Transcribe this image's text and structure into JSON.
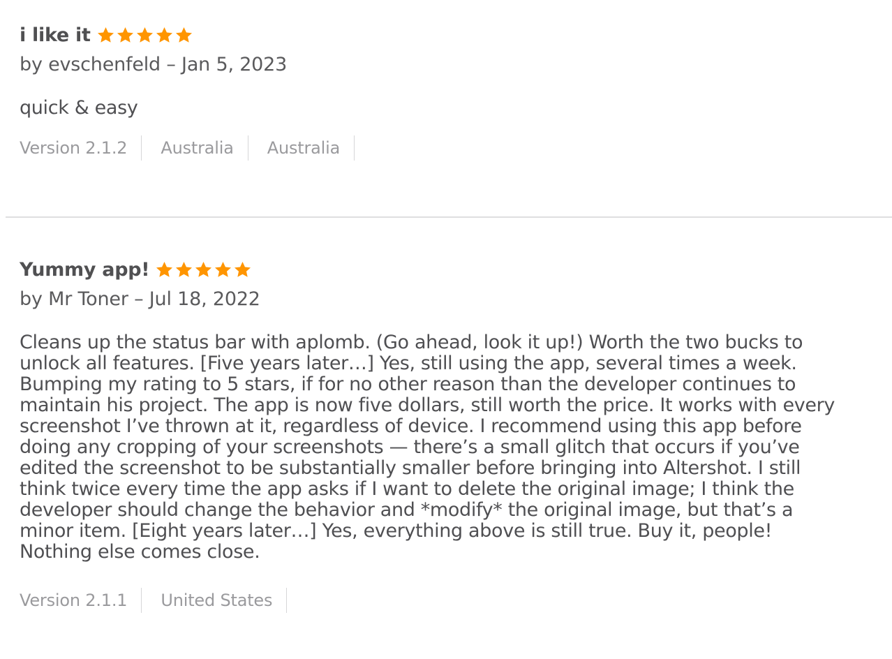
{
  "reviews": [
    {
      "title": "i like it",
      "rating": 5,
      "max_rating": 5,
      "byline": "by evschenfeld – Jan 5, 2023",
      "body": "quick & easy",
      "meta": [
        "Version 2.1.2",
        "Australia",
        "Australia"
      ]
    },
    {
      "title": "Yummy app!",
      "rating": 5,
      "max_rating": 5,
      "byline": "by Mr Toner – Jul 18, 2022",
      "body_lines": [
        "Cleans up the status bar with aplomb. (Go ahead, look it up!) Worth the two bucks to",
        "unlock all features. [Five years later…] Yes, still using the app, several times a week.",
        "Bumping my rating to 5 stars, if for no other reason than the developer continues to",
        "maintain his project. The app is now five dollars, still worth the price. It works with every",
        "screenshot I’ve thrown at it, regardless of device. I recommend using this app before",
        "doing any cropping of your screenshots — there’s a small glitch that occurs if you’ve",
        "edited the screenshot to be substantially smaller before bringing into Altershot. I still",
        "think twice every time the app asks if I want to delete the original image; I think the",
        "developer should change the behavior and *modify* the original image, but that’s a",
        "minor item. [Eight years later…] Yes, everything above is still true. Buy it, people!",
        "Nothing else comes close."
      ],
      "meta": [
        "Version 2.1.1",
        "United States"
      ]
    }
  ],
  "colors": {
    "star": "#ff9500",
    "title": "#505052",
    "meta": "#9a9a9d",
    "divider": "#dedee0"
  },
  "icons": {
    "star": "star-icon"
  }
}
